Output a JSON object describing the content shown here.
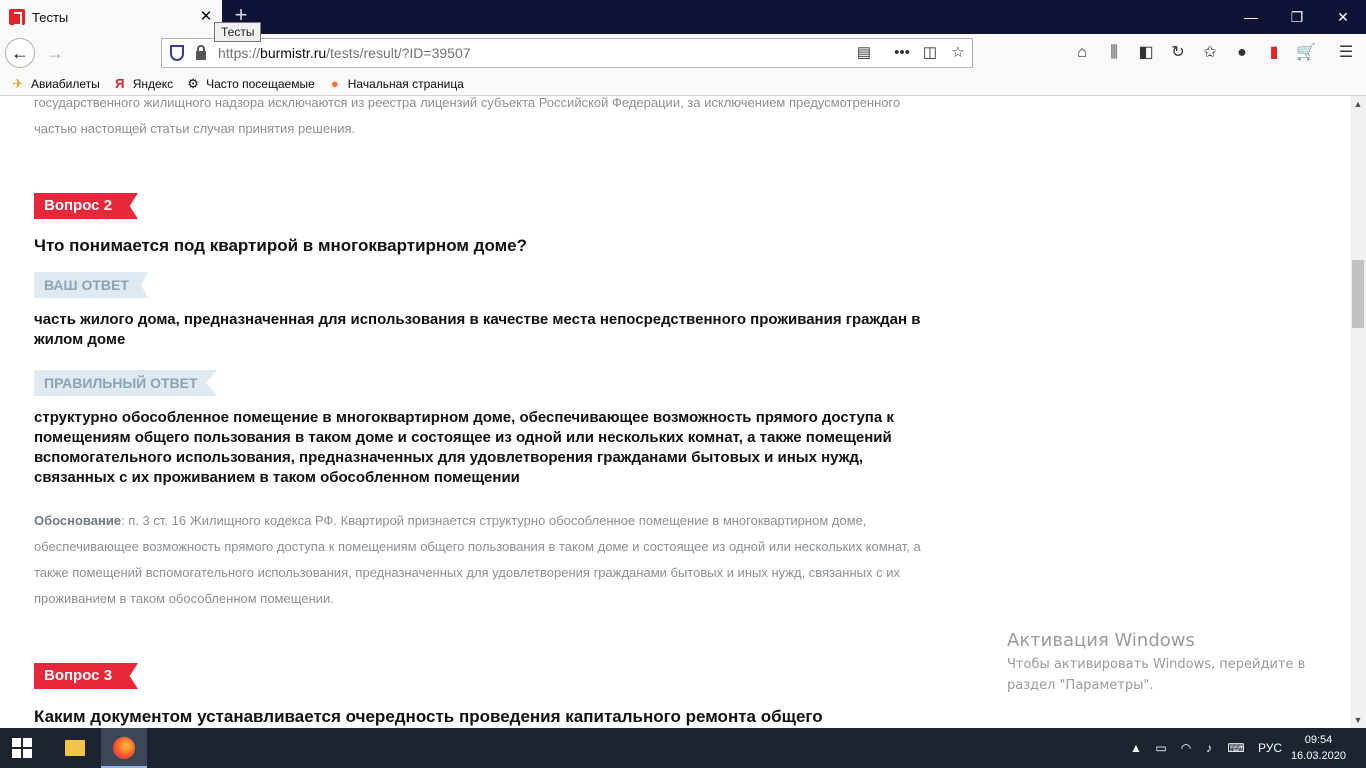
{
  "browser": {
    "tab_title": "Тесты",
    "tooltip": "Тесты",
    "url_prefix": "https://",
    "url_domain": "burmistr.ru",
    "url_path": "/tests/result/?ID=39507",
    "window_controls": [
      "—",
      "❐",
      "✕"
    ]
  },
  "bookmarks": [
    {
      "icon": "airplane-icon",
      "glyph": "✈",
      "label": "Авиабилеты"
    },
    {
      "icon": "yandex-icon",
      "glyph": "Я",
      "label": "Яндекс"
    },
    {
      "icon": "gear-icon",
      "glyph": "⚙",
      "label": "Часто посещаемые"
    },
    {
      "icon": "firefox-icon",
      "glyph": "●",
      "label": "Начальная страница"
    }
  ],
  "page": {
    "prev_basis_line1": "государственного жилищного надзора исключаются из реестра лицензий субъекта Российской Федерации, за исключением предусмотренного",
    "prev_basis_line2": "частью настоящей статьи случая принятия решения.",
    "q2": {
      "tag": "Вопрос 2",
      "title": "Что понимается под квартирой в многоквартирном доме?",
      "your_answer_label": "ВАШ ОТВЕТ",
      "your_answer": "часть жилого дома, предназначенная для использования в качестве места непосредственного проживания граждан в жилом доме",
      "correct_answer_label": "ПРАВИЛЬНЫЙ ОТВЕТ",
      "correct_answer": "структурно обособленное помещение в многоквартирном доме, обеспечивающее возможность прямого доступа к помещениям общего пользования в таком доме и состоящее из одной или нескольких комнат, а также помещений вспомогательного использования, предназначенных для удовлетворения гражданами бытовых и иных нужд, связанных с их проживанием в таком обособленном помещении",
      "basis_label": "Обоснование",
      "basis_text": ": п. 3 ст. 16 Жилищного кодекса РФ. Квартирой признается структурно обособленное помещение в многоквартирном доме, обеспечивающее возможность прямого доступа к помещениям общего пользования в таком доме и состоящее из одной или нескольких комнат, а также помещений вспомогательного использования, предназначенных для удовлетворения гражданами бытовых и иных нужд, связанных с их проживанием в таком обособленном помещении."
    },
    "q3": {
      "tag": "Вопрос 3",
      "title": "Каким документом устанавливается очередность проведения капитального ремонта общего"
    }
  },
  "activation": {
    "title": "Активация Windows",
    "subtitle": "Чтобы активировать Windows, перейдите в раздел \"Параметры\"."
  },
  "taskbar": {
    "language": "РУС",
    "time": "09:54",
    "date": "16.03.2020"
  },
  "colors": {
    "accent_red": "#e7283a",
    "tag_blue_bg": "#dfe9f1",
    "tag_blue_text": "#8aa3b5"
  }
}
